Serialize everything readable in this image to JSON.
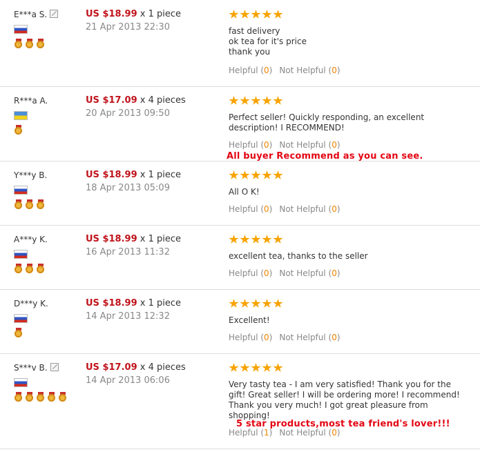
{
  "reviews": [
    {
      "buyer": "E***a S.",
      "has_edit_icon": true,
      "flag": "russia-flag",
      "medal_count": 3,
      "price": "US $18.99",
      "quantity": "x 1 piece",
      "date": "21 Apr 2013 22:30",
      "stars": 5,
      "text_lines": [
        "fast delivery",
        "ok tea for it's price",
        "thank you"
      ],
      "helpful_count": "0",
      "not_helpful_count": "0"
    },
    {
      "buyer": "R***a A.",
      "has_edit_icon": false,
      "flag": "ukraine-flag",
      "medal_count": 1,
      "price": "US $17.09",
      "quantity": "x 4 pieces",
      "date": "20 Apr 2013 09:50",
      "stars": 5,
      "text_lines": [
        "Perfect seller! Quickly responding, an excellent",
        "description! I RECOMMEND!"
      ],
      "helpful_count": "0",
      "not_helpful_count": "0"
    },
    {
      "buyer": "Y***y B.",
      "has_edit_icon": false,
      "flag": "russia-flag",
      "medal_count": 3,
      "price": "US $18.99",
      "quantity": "x 1 piece",
      "date": "18 Apr 2013 05:09",
      "stars": 5,
      "text_lines": [
        "All O K!"
      ],
      "helpful_count": "0",
      "not_helpful_count": "0"
    },
    {
      "buyer": "A***y K.",
      "has_edit_icon": false,
      "flag": "russia-flag",
      "medal_count": 3,
      "price": "US $18.99",
      "quantity": "x 1 piece",
      "date": "16 Apr 2013 11:32",
      "stars": 5,
      "text_lines": [
        "excellent tea, thanks to the seller"
      ],
      "helpful_count": "0",
      "not_helpful_count": "0"
    },
    {
      "buyer": "D***y K.",
      "has_edit_icon": false,
      "flag": "russia-flag",
      "medal_count": 1,
      "price": "US $18.99",
      "quantity": "x 1 piece",
      "date": "14 Apr 2013 12:32",
      "stars": 5,
      "text_lines": [
        "Excellent!"
      ],
      "helpful_count": "0",
      "not_helpful_count": "0"
    },
    {
      "buyer": "S***v B.",
      "has_edit_icon": true,
      "flag": "russia-flag",
      "medal_count": 5,
      "price": "US $17.09",
      "quantity": "x 4 pieces",
      "date": "14 Apr 2013 06:06",
      "stars": 5,
      "text_lines": [
        "Very tasty tea - I am very satisfied! Thank you for the",
        "gift! Great seller! I will be ordering more! I recommend!",
        "Thank you very much! I got great pleasure from",
        "shopping!"
      ],
      "helpful_count": "1",
      "not_helpful_count": "0"
    }
  ],
  "labels": {
    "helpful": "Helpful",
    "not_helpful": "Not Helpful"
  },
  "overlay_notes": {
    "recommend": "All buyer Recommend as you can see.",
    "five_star": "5 star products,most tea friend's lover!!!"
  },
  "colors": {
    "price": "#c0131b",
    "count": "#f08300",
    "muted": "#888888",
    "star": "#f7a300",
    "overlay": "#e30613"
  }
}
